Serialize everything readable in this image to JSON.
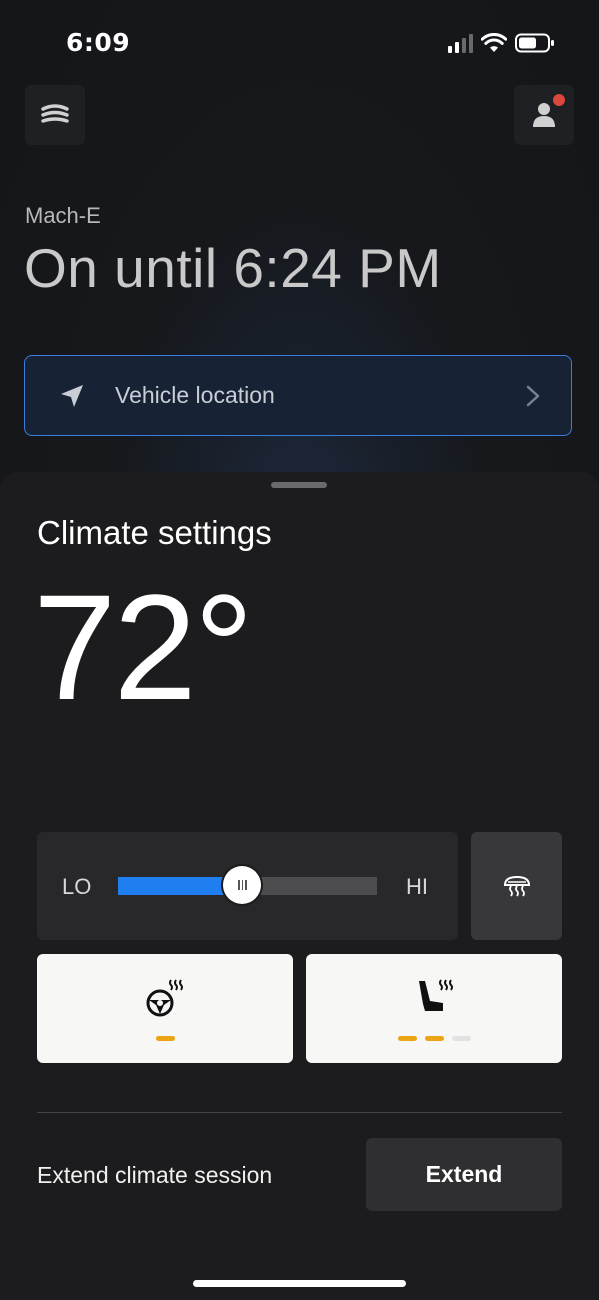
{
  "status_bar": {
    "time": "6:09",
    "signal_icon": "cellular-signal-icon",
    "wifi_icon": "wifi-icon",
    "battery_icon": "battery-icon"
  },
  "header": {
    "menu_icon": "vehicle-menu-icon",
    "profile_icon": "profile-icon",
    "has_notification": true,
    "notification_color": "#d9483b"
  },
  "vehicle": {
    "name": "Mach-E",
    "status": "On until 6:24 PM"
  },
  "location": {
    "label": "Vehicle location",
    "icon": "navigation-arrow-icon",
    "accent": "#3c7be0"
  },
  "climate": {
    "title": "Climate settings",
    "temperature": "72°",
    "slider": {
      "lo_label": "LO",
      "hi_label": "HI",
      "fraction": 0.48,
      "fill_color": "#1f7ff1"
    },
    "defrost_icon": "rear-defrost-icon",
    "heated_wheel": {
      "icon": "heated-steering-wheel-icon",
      "levels_total": 1,
      "levels_on": 1
    },
    "heated_seat": {
      "icon": "heated-seat-icon",
      "levels_total": 3,
      "levels_on": 2
    },
    "level_color": "#eba514"
  },
  "extend": {
    "label": "Extend climate session",
    "button_label": "Extend"
  }
}
